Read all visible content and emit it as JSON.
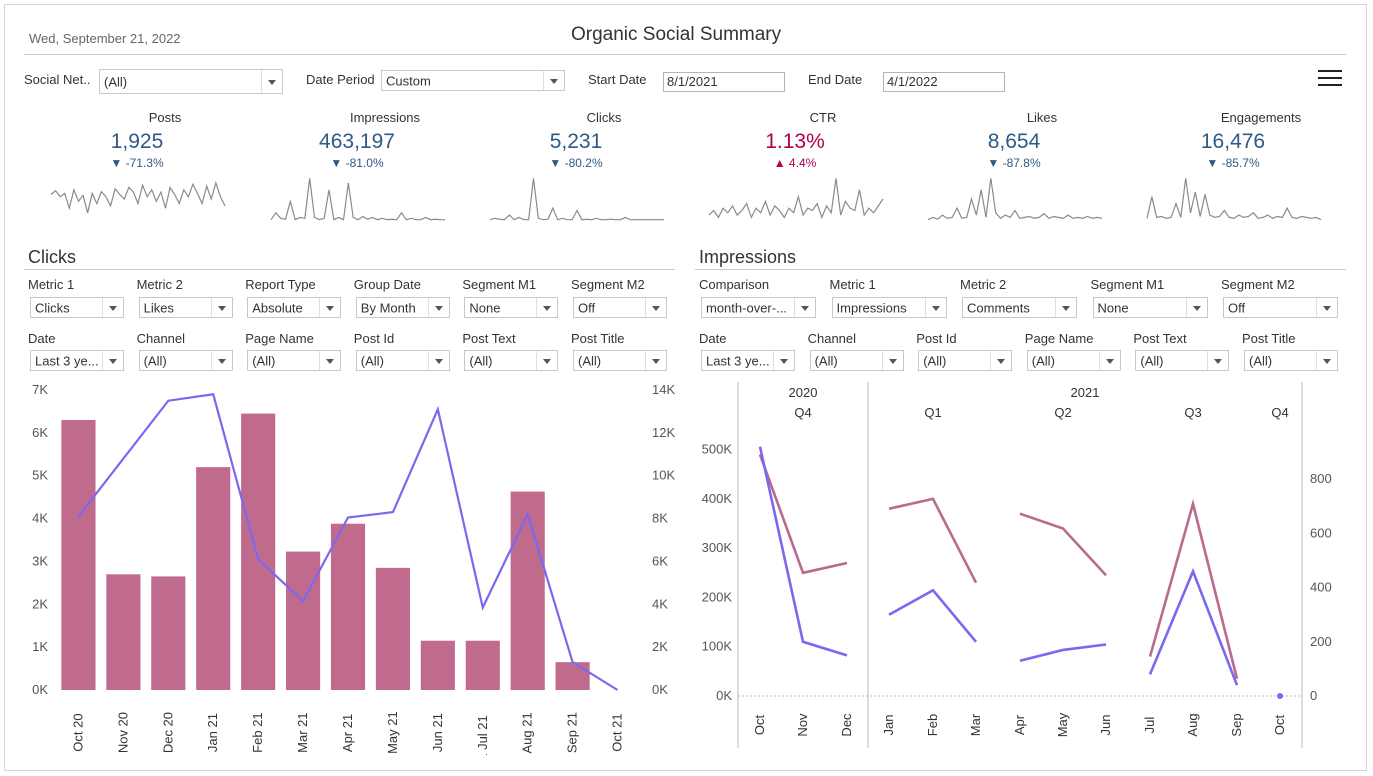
{
  "header": {
    "date": "Wed, September 21, 2022",
    "title": "Organic Social Summary"
  },
  "filters": {
    "social_network": {
      "label": "Social Net..",
      "value": "(All)"
    },
    "date_period": {
      "label": "Date Period",
      "value": "Custom"
    },
    "start_date": {
      "label": "Start Date",
      "value": "8/1/2021"
    },
    "end_date": {
      "label": "End Date",
      "value": "4/1/2022"
    }
  },
  "kpis": [
    {
      "label": "Posts",
      "value": "1,925",
      "delta": "▼ -71.3%",
      "color": "#2e5a87",
      "delta_color": "#2e5a87",
      "spark": [
        0.6,
        0.68,
        0.55,
        0.62,
        0.3,
        0.7,
        0.45,
        0.58,
        0.2,
        0.62,
        0.4,
        0.66,
        0.55,
        0.35,
        0.72,
        0.6,
        0.5,
        0.75,
        0.65,
        0.4,
        0.8,
        0.55,
        0.7,
        0.45,
        0.65,
        0.3,
        0.75,
        0.6,
        0.4,
        0.7,
        0.55,
        0.82,
        0.62,
        0.4,
        0.78,
        0.5,
        0.85,
        0.55,
        0.35
      ]
    },
    {
      "label": "Impressions",
      "value": "463,197",
      "delta": "▼ -81.0%",
      "color": "#2e5a87",
      "delta_color": "#2e5a87",
      "spark": [
        0.05,
        0.2,
        0.08,
        0.06,
        0.45,
        0.05,
        0.1,
        0.08,
        0.95,
        0.1,
        0.05,
        0.08,
        0.7,
        0.05,
        0.1,
        0.05,
        0.85,
        0.1,
        0.05,
        0.12,
        0.06,
        0.1,
        0.05,
        0.08,
        0.05,
        0.06,
        0.05,
        0.2,
        0.05,
        0.08,
        0.05,
        0.05,
        0.1,
        0.05,
        0.06,
        0.05,
        0.05
      ]
    },
    {
      "label": "Clicks",
      "value": "5,231",
      "delta": "▼ -80.2%",
      "color": "#2e5a87",
      "delta_color": "#2e5a87",
      "spark": [
        0.05,
        0.08,
        0.06,
        0.05,
        0.15,
        0.05,
        0.1,
        0.05,
        0.05,
        0.95,
        0.08,
        0.05,
        0.06,
        0.3,
        0.05,
        0.08,
        0.05,
        0.05,
        0.25,
        0.05,
        0.06,
        0.05,
        0.08,
        0.05,
        0.05,
        0.06,
        0.05,
        0.05,
        0.1,
        0.05,
        0.05,
        0.05,
        0.05,
        0.05,
        0.05,
        0.05,
        0.05
      ]
    },
    {
      "label": "CTR",
      "value": "1.13%",
      "delta": "▲ 4.4%",
      "color": "#b3004f",
      "delta_color": "#b3004f",
      "spark": [
        0.15,
        0.25,
        0.1,
        0.3,
        0.2,
        0.35,
        0.15,
        0.25,
        0.4,
        0.1,
        0.3,
        0.2,
        0.45,
        0.15,
        0.35,
        0.25,
        0.1,
        0.3,
        0.2,
        0.55,
        0.15,
        0.3,
        0.25,
        0.4,
        0.1,
        0.35,
        0.2,
        0.95,
        0.15,
        0.45,
        0.3,
        0.25,
        0.7,
        0.15,
        0.3,
        0.2,
        0.35,
        0.5
      ]
    },
    {
      "label": "Likes",
      "value": "8,654",
      "delta": "▼ -87.8%",
      "color": "#2e5a87",
      "delta_color": "#2e5a87",
      "spark": [
        0.05,
        0.1,
        0.06,
        0.15,
        0.08,
        0.1,
        0.3,
        0.08,
        0.1,
        0.5,
        0.15,
        0.7,
        0.1,
        0.95,
        0.2,
        0.08,
        0.15,
        0.1,
        0.25,
        0.08,
        0.1,
        0.12,
        0.08,
        0.1,
        0.18,
        0.08,
        0.12,
        0.1,
        0.08,
        0.15,
        0.08,
        0.1,
        0.08,
        0.12,
        0.08,
        0.1,
        0.08
      ]
    },
    {
      "label": "Engagements",
      "value": "16,476",
      "delta": "▼ -85.7%",
      "color": "#2e5a87",
      "delta_color": "#2e5a87",
      "spark": [
        0.08,
        0.55,
        0.1,
        0.12,
        0.08,
        0.1,
        0.4,
        0.1,
        0.95,
        0.2,
        0.65,
        0.12,
        0.6,
        0.15,
        0.1,
        0.12,
        0.25,
        0.1,
        0.08,
        0.15,
        0.1,
        0.12,
        0.2,
        0.08,
        0.1,
        0.15,
        0.08,
        0.12,
        0.1,
        0.3,
        0.1,
        0.08,
        0.12,
        0.1,
        0.08,
        0.1,
        0.05
      ]
    }
  ],
  "clicks_panel": {
    "title": "Clicks",
    "controls_row1": [
      {
        "label": "Metric 1",
        "value": "Clicks"
      },
      {
        "label": "Metric 2",
        "value": "Likes"
      },
      {
        "label": "Report Type",
        "value": "Absolute"
      },
      {
        "label": "Group Date",
        "value": "By Month"
      },
      {
        "label": "Segment M1",
        "value": "None"
      },
      {
        "label": "Segment M2",
        "value": "Off"
      }
    ],
    "controls_row2": [
      {
        "label": "Date",
        "value": "Last 3 ye..."
      },
      {
        "label": "Channel",
        "value": "(All)"
      },
      {
        "label": "Page Name",
        "value": "(All)"
      },
      {
        "label": "Post Id",
        "value": "(All)"
      },
      {
        "label": "Post Text",
        "value": "(All)"
      },
      {
        "label": "Post Title",
        "value": "(All)"
      }
    ]
  },
  "impressions_panel": {
    "title": "Impressions",
    "controls_row1": [
      {
        "label": "Comparison",
        "value": "month-over-..."
      },
      {
        "label": "Metric 1",
        "value": "Impressions"
      },
      {
        "label": "Metric 2",
        "value": "Comments"
      },
      {
        "label": "Segment M1",
        "value": "None"
      },
      {
        "label": "Segment M2",
        "value": "Off"
      }
    ],
    "controls_row2": [
      {
        "label": "Date",
        "value": "Last 3 ye..."
      },
      {
        "label": "Channel",
        "value": "(All)"
      },
      {
        "label": "Post Id",
        "value": "(All)"
      },
      {
        "label": "Page Name",
        "value": "(All)"
      },
      {
        "label": "Post Text",
        "value": "(All)"
      },
      {
        "label": "Post Title",
        "value": "(All)"
      }
    ]
  },
  "chart_data": [
    {
      "type": "bar",
      "categories": [
        "1 Oct 20",
        "1 Nov 20",
        "1 Dec 20",
        "1 Jan 21",
        "1 Feb 21",
        "1 Mar 21",
        "1 Apr 21",
        "1 May 21",
        "1 Jun 21",
        "1 Jul 21",
        "1 Aug 21",
        "1 Sep 21",
        "1 Oct 21"
      ],
      "series": [
        {
          "values": [
            6300,
            2700,
            2650,
            5200,
            6450,
            3230,
            3880,
            2850,
            1150,
            1150,
            4630,
            650,
            0
          ],
          "color": "#c06b8e"
        },
        {
          "values": [
            8100,
            10800,
            13500,
            13800,
            6100,
            4150,
            8050,
            8300,
            13100,
            3850,
            8200,
            1300,
            0
          ],
          "color": "#7b68ee",
          "type": "line",
          "axis": "right"
        }
      ],
      "ylim_left": [
        0,
        7000
      ],
      "ylim_right": [
        0,
        14000
      ],
      "yticks_left": [
        "0K",
        "1K",
        "2K",
        "3K",
        "4K",
        "5K",
        "6K",
        "7K"
      ],
      "yticks_right": [
        "0K",
        "2K",
        "4K",
        "6K",
        "8K",
        "10K",
        "12K",
        "14K"
      ]
    },
    {
      "type": "line",
      "year_headers": [
        "2020",
        "2021"
      ],
      "quarter_headers": [
        "Q4",
        "Q1",
        "Q2",
        "Q3",
        "Q4"
      ],
      "months": [
        "Oct",
        "Nov",
        "Dec",
        "Jan",
        "Feb",
        "Mar",
        "Apr",
        "May",
        "Jun",
        "Jul",
        "Aug",
        "Sep",
        "Oct"
      ],
      "series": [
        {
          "values": [
            490000,
            250000,
            270000,
            380000,
            400000,
            230000,
            370000,
            340000,
            245000,
            80000,
            390000,
            35000,
            null
          ],
          "color": "#b86b8e",
          "axis": "left"
        },
        {
          "values": [
            920,
            200,
            150,
            300,
            390,
            200,
            130,
            170,
            190,
            80,
            460,
            40,
            0
          ],
          "color": "#7b68ee",
          "axis": "right"
        }
      ],
      "ylim_left": [
        0,
        550000
      ],
      "ylim_right": [
        0,
        1000
      ],
      "yticks_left": [
        "0K",
        "100K",
        "200K",
        "300K",
        "400K",
        "500K"
      ],
      "yticks_right": [
        "0",
        "200",
        "400",
        "600",
        "800"
      ]
    }
  ]
}
